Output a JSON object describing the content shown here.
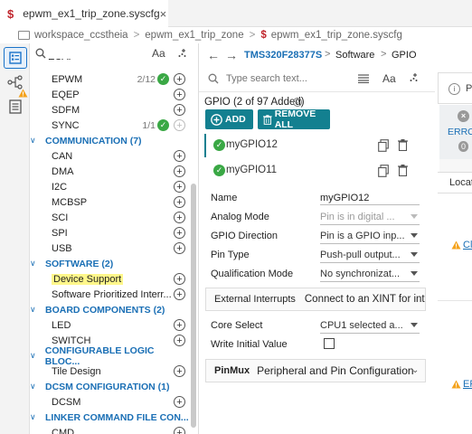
{
  "tab": {
    "logo": "$",
    "title": "epwm_ex1_trip_zone.syscfg",
    "close": "×"
  },
  "breadcrumb": {
    "items": [
      "workspace_ccstheia",
      "epwm_ex1_trip_zone",
      "epwm_ex1_trip_zone.syscfg"
    ],
    "separator": ">"
  },
  "left_panel": {
    "aa": "Aa",
    "tree": [
      {
        "kind": "item",
        "label": "EPWM",
        "count": "2/12",
        "check": true,
        "plus": "enabled"
      },
      {
        "kind": "item",
        "label": "EQEP",
        "plus": "enabled"
      },
      {
        "kind": "item",
        "label": "SDFM",
        "plus": "enabled"
      },
      {
        "kind": "item",
        "label": "SYNC",
        "count": "1/1",
        "check": true,
        "plus": "disabled"
      },
      {
        "kind": "cat",
        "label": "COMMUNICATION (7)"
      },
      {
        "kind": "item",
        "label": "CAN",
        "plus": "enabled"
      },
      {
        "kind": "item",
        "label": "DMA",
        "plus": "enabled"
      },
      {
        "kind": "item",
        "label": "I2C",
        "plus": "enabled"
      },
      {
        "kind": "item",
        "label": "MCBSP",
        "plus": "enabled"
      },
      {
        "kind": "item",
        "label": "SCI",
        "plus": "enabled"
      },
      {
        "kind": "item",
        "label": "SPI",
        "plus": "enabled"
      },
      {
        "kind": "item",
        "label": "USB",
        "plus": "enabled"
      },
      {
        "kind": "cat",
        "label": "SOFTWARE (2)"
      },
      {
        "kind": "item",
        "label": "Device Support",
        "plus": "enabled",
        "highlight": true
      },
      {
        "kind": "item",
        "label": "Software Prioritized Interr...",
        "plus": "enabled"
      },
      {
        "kind": "cat",
        "label": "BOARD COMPONENTS (2)"
      },
      {
        "kind": "item",
        "label": "LED",
        "plus": "enabled"
      },
      {
        "kind": "item",
        "label": "SWITCH",
        "plus": "enabled"
      },
      {
        "kind": "cat",
        "label": "CONFIGURABLE LOGIC BLOC..."
      },
      {
        "kind": "item",
        "label": "Tile Design",
        "plus": "enabled"
      },
      {
        "kind": "cat",
        "label": "DCSM CONFIGURATION (1)"
      },
      {
        "kind": "item",
        "label": "DCSM",
        "plus": "enabled"
      },
      {
        "kind": "cat",
        "label": "LINKER COMMAND FILE CON..."
      },
      {
        "kind": "item",
        "label": "CMD",
        "plus": "enabled"
      }
    ]
  },
  "center": {
    "nav": {
      "device": "TMS320F28377S",
      "path": [
        "Software",
        "GPIO"
      ]
    },
    "search": {
      "placeholder": "Type search text...",
      "aa": "Aa"
    },
    "module_title": "GPIO (2 of 97 Added)",
    "help": "?",
    "add_label": "ADD",
    "remove_all_label": "REMOVE ALL",
    "instances": [
      {
        "name": "myGPIO12",
        "selected": true
      },
      {
        "name": "myGPIO11",
        "selected": false
      }
    ],
    "properties": {
      "name_label": "Name",
      "name_value": "myGPIO12",
      "analog_label": "Analog Mode",
      "analog_value": "Pin is in digital ...",
      "direction_label": "GPIO Direction",
      "direction_value": "Pin is a GPIO inp...",
      "pintype_label": "Pin Type",
      "pintype_value": "Push-pull output...",
      "qual_label": "Qualification Mode",
      "qual_value": "No synchronizat...",
      "ext_int_label": "External Interrupts",
      "ext_int_value": "Connect to an XINT for inte",
      "core_label": "Core Select",
      "core_value": "CPU1 selected a...",
      "write_label": "Write Initial Value",
      "pinmux_label": "PinMux",
      "pinmux_value": "Peripheral and Pin Configuration"
    }
  },
  "right_panel": {
    "error_label": "ERRO",
    "error_count": "0",
    "loc_label": "Locat",
    "warn1": "Cl",
    "warn2": "EF"
  },
  "colors": {
    "teal": "#138090",
    "accent_blue": "#1a6fb5",
    "check_green": "#3aa845",
    "logo_red": "#c0262d",
    "highlight": "#fff78a"
  }
}
